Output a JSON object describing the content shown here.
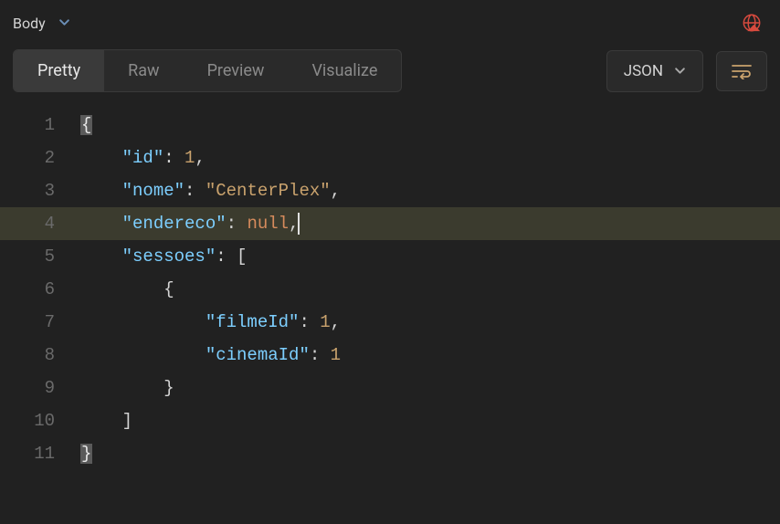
{
  "header": {
    "section_label": "Body"
  },
  "tabs": {
    "pretty": "Pretty",
    "raw": "Raw",
    "preview": "Preview",
    "visualize": "Visualize"
  },
  "format_select": {
    "value": "JSON"
  },
  "code": {
    "lines": {
      "l1": "{",
      "l2": {
        "indent": "    ",
        "key": "\"id\"",
        "sep": ": ",
        "val": "1",
        "end": ","
      },
      "l3": {
        "indent": "    ",
        "key": "\"nome\"",
        "sep": ": ",
        "val": "\"CenterPlex\"",
        "end": ","
      },
      "l4": {
        "indent": "    ",
        "key": "\"endereco\"",
        "sep": ": ",
        "val": "null",
        "end": ","
      },
      "l5": {
        "indent": "    ",
        "key": "\"sessoes\"",
        "sep": ": ",
        "val": "["
      },
      "l6": {
        "indent": "        ",
        "val": "{"
      },
      "l7": {
        "indent": "            ",
        "key": "\"filmeId\"",
        "sep": ": ",
        "val": "1",
        "end": ","
      },
      "l8": {
        "indent": "            ",
        "key": "\"cinemaId\"",
        "sep": ": ",
        "val": "1"
      },
      "l9": {
        "indent": "        ",
        "val": "}"
      },
      "l10": {
        "indent": "    ",
        "val": "]"
      },
      "l11": "}"
    },
    "line_numbers": [
      "1",
      "2",
      "3",
      "4",
      "5",
      "6",
      "7",
      "8",
      "9",
      "10",
      "11"
    ]
  }
}
